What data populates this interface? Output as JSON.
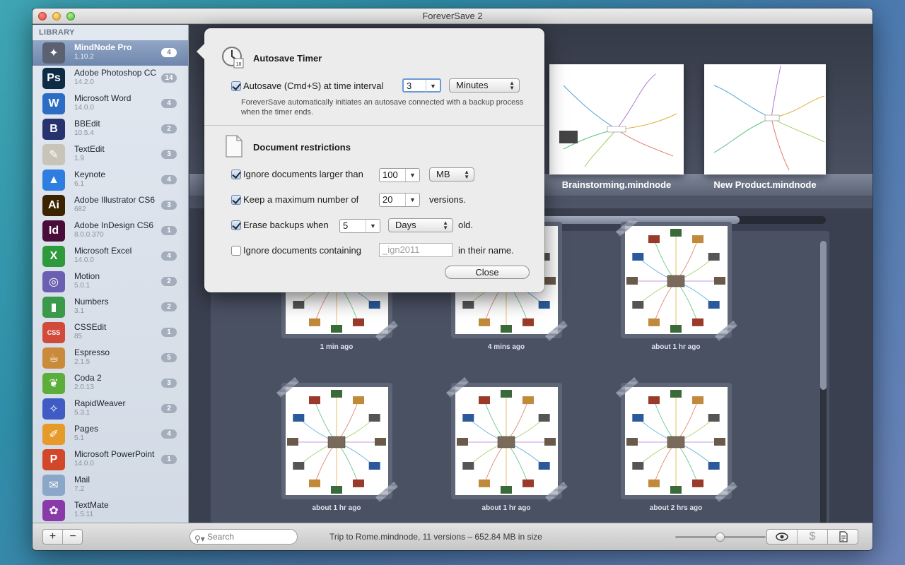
{
  "window": {
    "title": "ForeverSave 2"
  },
  "sidebar": {
    "header": "LIBRARY",
    "items": [
      {
        "name": "MindNode Pro",
        "version": "1.10.2",
        "count": "4",
        "icon": "mindnode-icon",
        "color": "#5b6170",
        "glyph": "✦",
        "selected": true
      },
      {
        "name": "Adobe Photoshop CC",
        "version": "14.2.0",
        "count": "14",
        "icon": "photoshop-icon",
        "color": "#0d2b45",
        "glyph": "Ps"
      },
      {
        "name": "Microsoft Word",
        "version": "14.0.0",
        "count": "4",
        "icon": "word-icon",
        "color": "#2b6cc4",
        "glyph": "W"
      },
      {
        "name": "BBEdit",
        "version": "10.5.4",
        "count": "2",
        "icon": "bbedit-icon",
        "color": "#27336e",
        "glyph": "B"
      },
      {
        "name": "TextEdit",
        "version": "1.9",
        "count": "3",
        "icon": "textedit-icon",
        "color": "#c9c4b8",
        "glyph": "✎"
      },
      {
        "name": "Keynote",
        "version": "6.1",
        "count": "4",
        "icon": "keynote-icon",
        "color": "#2e7de0",
        "glyph": "▲"
      },
      {
        "name": "Adobe Illustrator CS6",
        "version": "682",
        "count": "3",
        "icon": "illustrator-icon",
        "color": "#3b2200",
        "glyph": "Ai"
      },
      {
        "name": "Adobe InDesign CS6",
        "version": "8.0.0.370",
        "count": "1",
        "icon": "indesign-icon",
        "color": "#4a0d3a",
        "glyph": "Id"
      },
      {
        "name": "Microsoft Excel",
        "version": "14.0.0",
        "count": "4",
        "icon": "excel-icon",
        "color": "#2e9a3c",
        "glyph": "X"
      },
      {
        "name": "Motion",
        "version": "5.0.1",
        "count": "2",
        "icon": "motion-icon",
        "color": "#6a5fb0",
        "glyph": "◎"
      },
      {
        "name": "Numbers",
        "version": "3.1",
        "count": "2",
        "icon": "numbers-icon",
        "color": "#3a9a4a",
        "glyph": "▮"
      },
      {
        "name": "CSSEdit",
        "version": "85",
        "count": "1",
        "icon": "cssedit-icon",
        "color": "#d24a3a",
        "glyph": "CSS"
      },
      {
        "name": "Espresso",
        "version": "2.1.5",
        "count": "5",
        "icon": "espresso-icon",
        "color": "#c98a3a",
        "glyph": "☕"
      },
      {
        "name": "Coda 2",
        "version": "2.0.13",
        "count": "3",
        "icon": "coda-icon",
        "color": "#5cae3a",
        "glyph": "❦"
      },
      {
        "name": "RapidWeaver",
        "version": "5.3.1",
        "count": "2",
        "icon": "rapidweaver-icon",
        "color": "#3e5cc4",
        "glyph": "✧"
      },
      {
        "name": "Pages",
        "version": "5.1",
        "count": "4",
        "icon": "pages-icon",
        "color": "#e59a2a",
        "glyph": "✐"
      },
      {
        "name": "Microsoft PowerPoint",
        "version": "14.0.0",
        "count": "1",
        "icon": "powerpoint-icon",
        "color": "#d2462a",
        "glyph": "P"
      },
      {
        "name": "Mail",
        "version": "7.2",
        "count": "",
        "icon": "mail-icon",
        "color": "#8aa6c8",
        "glyph": "✉"
      },
      {
        "name": "TextMate",
        "version": "1.5.11",
        "count": "",
        "icon": "textmate-icon",
        "color": "#8a3aa8",
        "glyph": "✿"
      }
    ]
  },
  "shelf": {
    "documents": [
      {
        "title": "Brainstorming.mindnode"
      },
      {
        "title": "New Product.mindnode"
      }
    ]
  },
  "versions": {
    "progress": 0.86,
    "scroll_fraction": 0.52,
    "items": [
      {
        "label": "1 min ago"
      },
      {
        "label": "4 mins ago"
      },
      {
        "label": "about 1 hr ago"
      },
      {
        "label": "about 1 hr ago"
      },
      {
        "label": "about 1 hr ago"
      },
      {
        "label": "about 2 hrs ago"
      }
    ]
  },
  "popover": {
    "autosave": {
      "title": "Autosave Timer",
      "checkbox_label": "Autosave (Cmd+S) at time interval",
      "checked": true,
      "interval_value": "3",
      "unit": "Minutes",
      "description": "ForeverSave automatically initiates an autosave connected with a backup process when the timer ends."
    },
    "restrictions": {
      "title": "Document restrictions",
      "ignore_larger": {
        "label": "Ignore documents larger than",
        "value": "100",
        "unit": "MB",
        "checked": true
      },
      "keep_max": {
        "label": "Keep a maximum number of",
        "value": "20",
        "suffix": "versions.",
        "checked": true
      },
      "erase": {
        "label": "Erase backups when",
        "value": "5",
        "unit": "Days",
        "suffix": "old.",
        "checked": true
      },
      "ignore_containing": {
        "label": "Ignore documents containing",
        "placeholder": "_ign2011",
        "suffix": "in their name.",
        "checked": false
      }
    },
    "close_label": "Close"
  },
  "bottombar": {
    "add_label": "+",
    "remove_label": "−",
    "search_placeholder": "Search",
    "status": "Trip to Rome.mindnode, 11 versions – 652.84 MB in size",
    "zoom": 0.5
  }
}
